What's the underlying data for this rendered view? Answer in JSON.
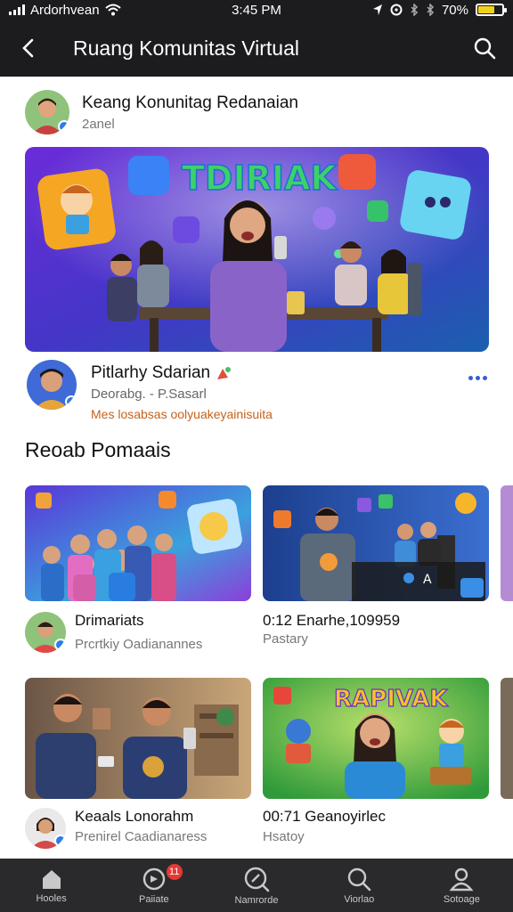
{
  "status_bar": {
    "carrier": "Ardorhvean",
    "time": "3:45 PM",
    "battery_text": "70%",
    "battery_level": 0.7,
    "battery_color": "#f2d21b"
  },
  "app_bar": {
    "title": "Ruang Komunitas Virtual",
    "back_icon": "back-arrow-icon",
    "search_icon": "search-icon"
  },
  "channel": {
    "name": "Keang Konunitag Redanaian",
    "subtitle": "2anel"
  },
  "hero": {
    "banner_text": "TDIRIAK"
  },
  "post": {
    "title": "Pitlarhy Sdarian",
    "meta": "Deorabg. - P.Sasarl",
    "tag": "Mes losabsas oolyuakeyainisuita",
    "tag_color": "#c5621b",
    "more_icon": "more-horizontal-icon"
  },
  "section": {
    "title": "Reoab Pomaais"
  },
  "cards": [
    {
      "title": "Drimariats",
      "subtitle": "Prcrtkiy  Oadianannes",
      "has_avatar": true
    },
    {
      "title": "0:12   Enarhe,109959",
      "subtitle": "Pastary",
      "has_avatar": false
    },
    {
      "title": "Keaals Lonorahm",
      "subtitle": "Prenirel  Caadianaress",
      "has_avatar": true
    },
    {
      "title": "00:71   Geanoyirlec",
      "subtitle": "Hsatoy",
      "has_avatar": false
    }
  ],
  "card4_banner": "RAPIVAK",
  "bottom_nav": [
    {
      "label": "Hooles",
      "icon": "home-icon"
    },
    {
      "label": "Paiiate",
      "icon": "notifications-icon",
      "badge": "11"
    },
    {
      "label": "Namrorde",
      "icon": "explore-icon"
    },
    {
      "label": "Viorlao",
      "icon": "search-icon"
    },
    {
      "label": "Sotoage",
      "icon": "profile-icon"
    }
  ]
}
